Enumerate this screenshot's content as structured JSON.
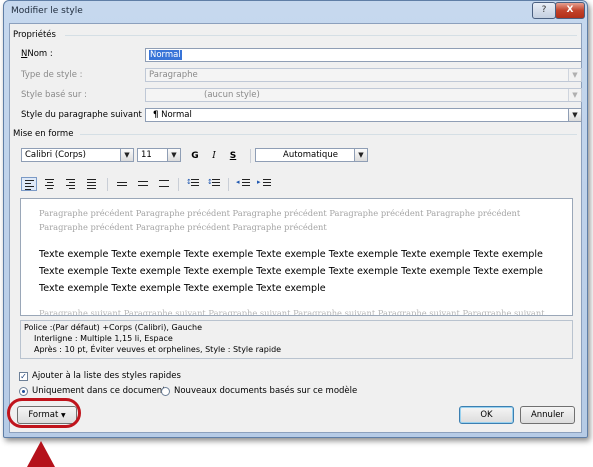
{
  "window": {
    "title": "Modifier le style",
    "help_label": "?",
    "close_label": "X"
  },
  "properties": {
    "section_label": "Propriétés",
    "name_label": "Nom :",
    "name_value": "Normal",
    "style_type_label": "Type de style :",
    "style_type_value": "Paragraphe",
    "based_on_label": "Style basé sur :",
    "based_on_value": "(aucun style)",
    "next_style_label": "Style du paragraphe suivant :",
    "next_style_value": "Normal"
  },
  "formatting": {
    "section_label": "Mise en forme",
    "font": "Calibri (Corps)",
    "size": "11",
    "bold_label": "G",
    "italic_label": "I",
    "underline_label": "S",
    "color": "Automatique"
  },
  "preview": {
    "previous_text": "Paragraphe précédent Paragraphe précédent Paragraphe précédent Paragraphe précédent Paragraphe précédent Paragraphe précédent Paragraphe précédent Paragraphe précédent",
    "sample_text": "Texte exemple Texte exemple Texte exemple Texte exemple Texte exemple Texte exemple Texte exemple Texte exemple Texte exemple Texte exemple Texte exemple Texte exemple Texte exemple Texte exemple Texte exemple Texte exemple Texte exemple Texte exemple",
    "next_text": "Paragraphe suivant Paragraphe suivant Paragraphe suivant Paragraphe suivant Paragraphe suivant Paragraphe suivant"
  },
  "description": {
    "line1": "Police :(Par défaut) +Corps (Calibri), Gauche",
    "line2": "Interligne : Multiple 1,15 li, Espace",
    "line3": "Après : 10 pt, Éviter veuves et orphelines, Style : Style rapide"
  },
  "options": {
    "add_quick_styles": "Ajouter à la liste des styles rapides",
    "only_this_document": "Uniquement dans ce document",
    "new_documents": "Nouveaux documents basés sur ce modèle"
  },
  "buttons": {
    "format": "Format",
    "ok": "OK",
    "cancel": "Annuler"
  },
  "colors": {
    "highlight": "#c0141c",
    "arrow": "#b5121b",
    "selection": "#3874d8"
  }
}
